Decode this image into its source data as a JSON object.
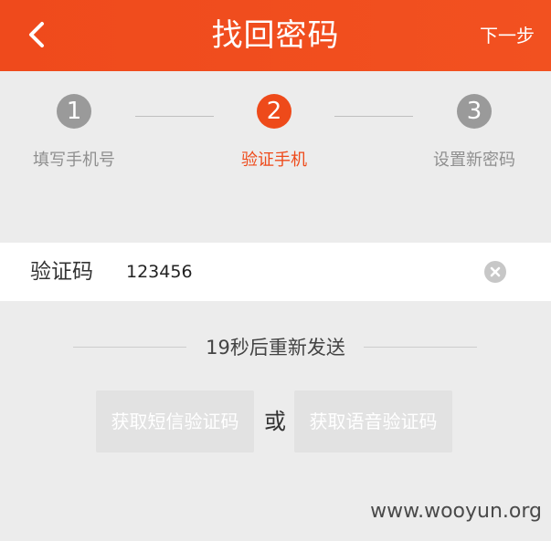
{
  "header": {
    "title": "找回密码",
    "next_label": "下一步",
    "bg_color": "#ef4a1c"
  },
  "steps": [
    {
      "number": "1",
      "label": "填写手机号",
      "active": false
    },
    {
      "number": "2",
      "label": "验证手机",
      "active": true
    },
    {
      "number": "3",
      "label": "设置新密码",
      "active": false
    }
  ],
  "verify": {
    "label": "验证码",
    "value": "123456",
    "placeholder": ""
  },
  "countdown": {
    "text": "19秒后重新发送"
  },
  "actions": {
    "sms_label": "获取短信验证码",
    "or_label": "或",
    "voice_label": "获取语音验证码"
  },
  "watermark": "www.wooyun.org",
  "colors": {
    "accent": "#ee4a1a",
    "inactive_step": "#9a9a9a",
    "disabled_button": "#e2e2e2"
  }
}
